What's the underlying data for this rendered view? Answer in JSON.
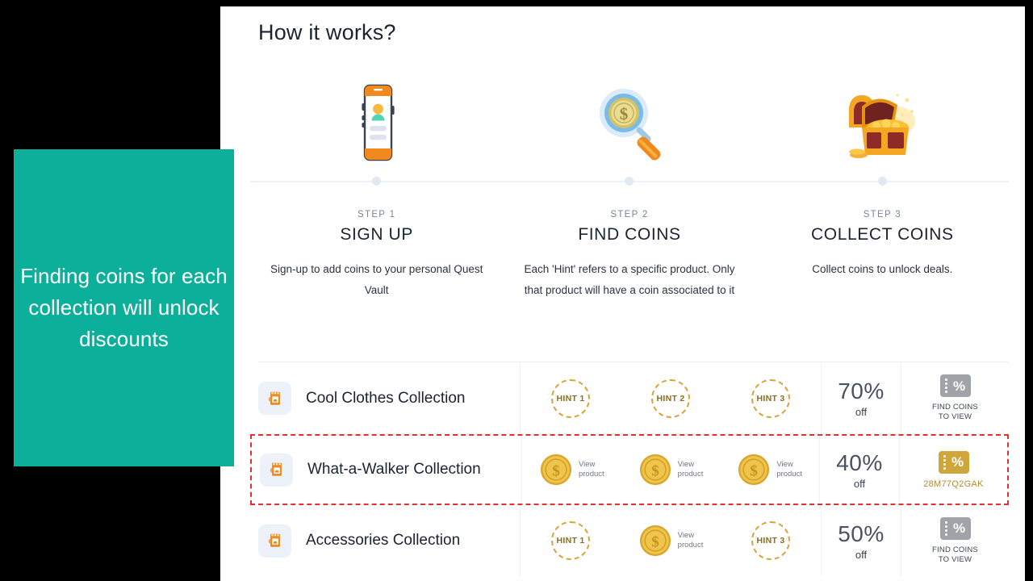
{
  "promo": {
    "text": "Finding coins for each collection will unlock discounts",
    "bg_color": "#0CB09A",
    "text_color": "#FFFFFF"
  },
  "heading": "How it works?",
  "steps": [
    {
      "number": "STEP 1",
      "title": "SIGN UP",
      "desc": "Sign-up to add coins to your personal Quest Vault",
      "icon": "smartphone-signup-icon"
    },
    {
      "number": "STEP 2",
      "title": "FIND COINS",
      "desc": "Each 'Hint' refers to a specific product. Only that product will have a coin associated to it",
      "icon": "magnifier-coin-icon"
    },
    {
      "number": "STEP 3",
      "title": "COLLECT COINS",
      "desc": "Collect coins to unlock deals.",
      "icon": "treasure-chest-icon"
    }
  ],
  "collections": [
    {
      "name": "Cool Clothes Collection",
      "icon": "collection-bag-icon",
      "highlighted": false,
      "slots": [
        {
          "type": "hint",
          "label": "HINT 1"
        },
        {
          "type": "hint",
          "label": "HINT 2"
        },
        {
          "type": "hint",
          "label": "HINT 3"
        }
      ],
      "discount": "70%",
      "discount_suffix": "off",
      "action_state": "locked",
      "action_label": "FIND COINS TO VIEW"
    },
    {
      "name": "What-a-Walker Collection",
      "icon": "collection-bag-icon",
      "highlighted": true,
      "slots": [
        {
          "type": "coin",
          "label": "View product"
        },
        {
          "type": "coin",
          "label": "View product"
        },
        {
          "type": "coin",
          "label": "View product"
        }
      ],
      "discount": "40%",
      "discount_suffix": "off",
      "action_state": "unlocked",
      "action_label": "28M77Q2GAK"
    },
    {
      "name": "Accessories Collection",
      "icon": "collection-bag-icon",
      "highlighted": false,
      "slots": [
        {
          "type": "hint",
          "label": "HINT 1"
        },
        {
          "type": "coin",
          "label": "View product"
        },
        {
          "type": "hint",
          "label": "HINT 3"
        }
      ],
      "discount": "50%",
      "discount_suffix": "off",
      "action_state": "locked",
      "action_label": "FIND COINS TO VIEW"
    }
  ],
  "colors": {
    "accent_orange": "#F08A1E",
    "gold": "#D9A43A",
    "highlight_border": "#E03131",
    "locked_gray": "#A0A3A8"
  }
}
